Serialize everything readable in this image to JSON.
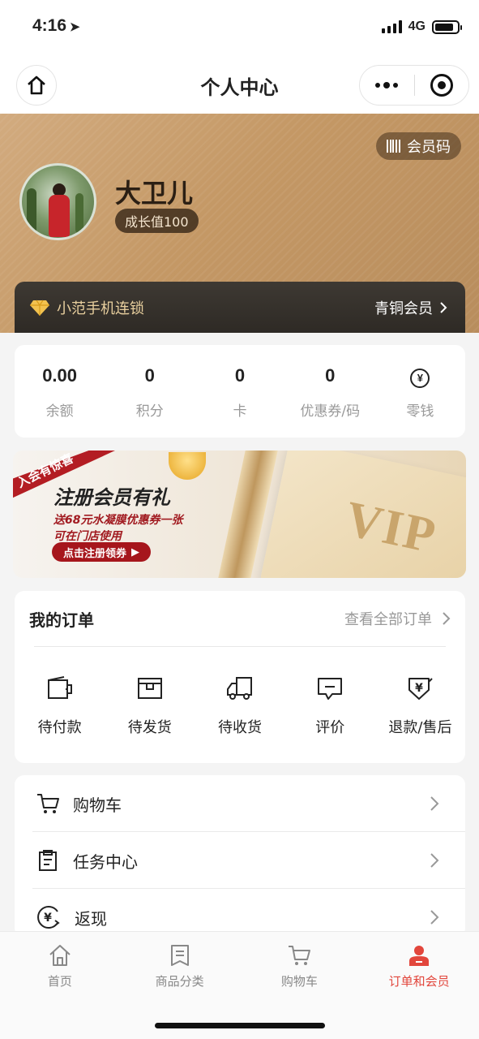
{
  "status": {
    "time": "4:16",
    "network": "4G"
  },
  "nav": {
    "title": "个人中心"
  },
  "header": {
    "member_code_label": "会员码",
    "username": "大卫儿",
    "growth": "成长值100",
    "store_name": "小范手机连锁",
    "member_level": "青铜会员"
  },
  "stats": [
    {
      "value": "0.00",
      "label": "余额"
    },
    {
      "value": "0",
      "label": "积分"
    },
    {
      "value": "0",
      "label": "卡"
    },
    {
      "value": "0",
      "label": "优惠券/码"
    },
    {
      "value": "",
      "label": "零钱",
      "icon": "yuan-coin-icon"
    }
  ],
  "banner": {
    "ribbon": "入会有惊喜",
    "title": "注册会员有礼",
    "line1": "送68元水凝膜优惠券一张",
    "line2": "可在门店使用",
    "button": "点击注册领券",
    "vip": "VIP"
  },
  "orders": {
    "title": "我的订单",
    "view_all": "查看全部订单",
    "items": [
      {
        "label": "待付款",
        "icon": "wallet-icon"
      },
      {
        "label": "待发货",
        "icon": "package-icon"
      },
      {
        "label": "待收货",
        "icon": "truck-icon"
      },
      {
        "label": "评价",
        "icon": "comment-icon"
      },
      {
        "label": "退款/售后",
        "icon": "refund-icon"
      }
    ]
  },
  "menu": [
    {
      "label": "购物车",
      "icon": "cart-icon"
    },
    {
      "label": "任务中心",
      "icon": "clipboard-icon"
    },
    {
      "label": "返现",
      "icon": "cashback-icon"
    }
  ],
  "tabbar": [
    {
      "label": "首页",
      "icon": "home-icon"
    },
    {
      "label": "商品分类",
      "icon": "category-icon"
    },
    {
      "label": "购物车",
      "icon": "cart-icon"
    },
    {
      "label": "订单和会员",
      "icon": "user-icon",
      "active": true
    }
  ],
  "colors": {
    "accent": "#e2463c",
    "gold": "#c49865",
    "dark_bar": "#2e2a25"
  }
}
